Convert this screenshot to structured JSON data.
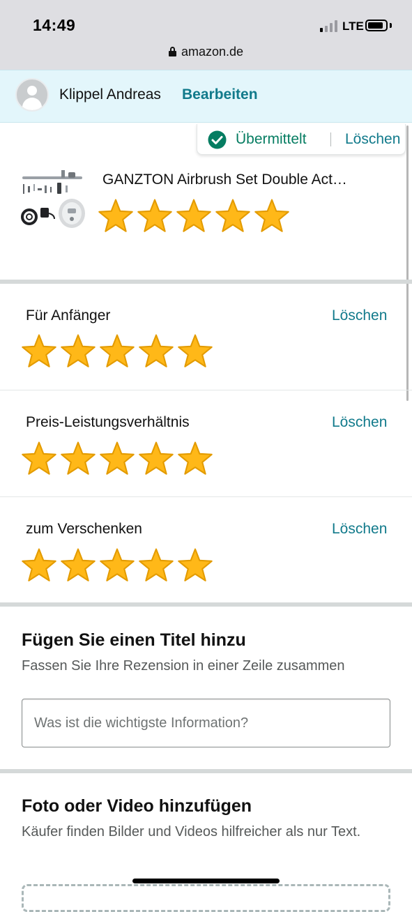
{
  "status_bar": {
    "time": "14:49",
    "network": "LTE",
    "signal_bars_active": 1,
    "signal_bars_total": 4,
    "url": "amazon.de"
  },
  "profile": {
    "name": "Klippel Andreas",
    "edit_label": "Bearbeiten"
  },
  "submission": {
    "status_label": "Übermittelt",
    "delete_label": "Löschen"
  },
  "product": {
    "title": "GANZTON Airbrush Set Double Act…",
    "rating": 5,
    "max_rating": 5
  },
  "aspects": [
    {
      "label": "Für Anfänger",
      "delete_label": "Löschen",
      "rating": 5
    },
    {
      "label": "Preis-Leistungsverhältnis",
      "delete_label": "Löschen",
      "rating": 5
    },
    {
      "label": "zum Verschenken",
      "delete_label": "Löschen",
      "rating": 5
    }
  ],
  "title_section": {
    "heading": "Fügen Sie einen Titel hinzu",
    "hint": "Fassen Sie Ihre Rezension in einer Zeile zusammen",
    "input_value": "",
    "input_placeholder": "Was ist die wichtigste Information?"
  },
  "media_section": {
    "heading": "Foto oder Video hinzufügen",
    "hint": "Käufer finden Bilder und Videos hilfreicher als nur Text."
  },
  "colors": {
    "link": "#117a8b",
    "success": "#067d62",
    "star_fill": "#ffb818",
    "star_stroke": "#e39b00",
    "profile_bar": "#e3f6fb"
  },
  "icons": {
    "lock": "lock-icon",
    "check": "check-circle-icon",
    "avatar": "avatar-icon",
    "star": "star-icon"
  }
}
